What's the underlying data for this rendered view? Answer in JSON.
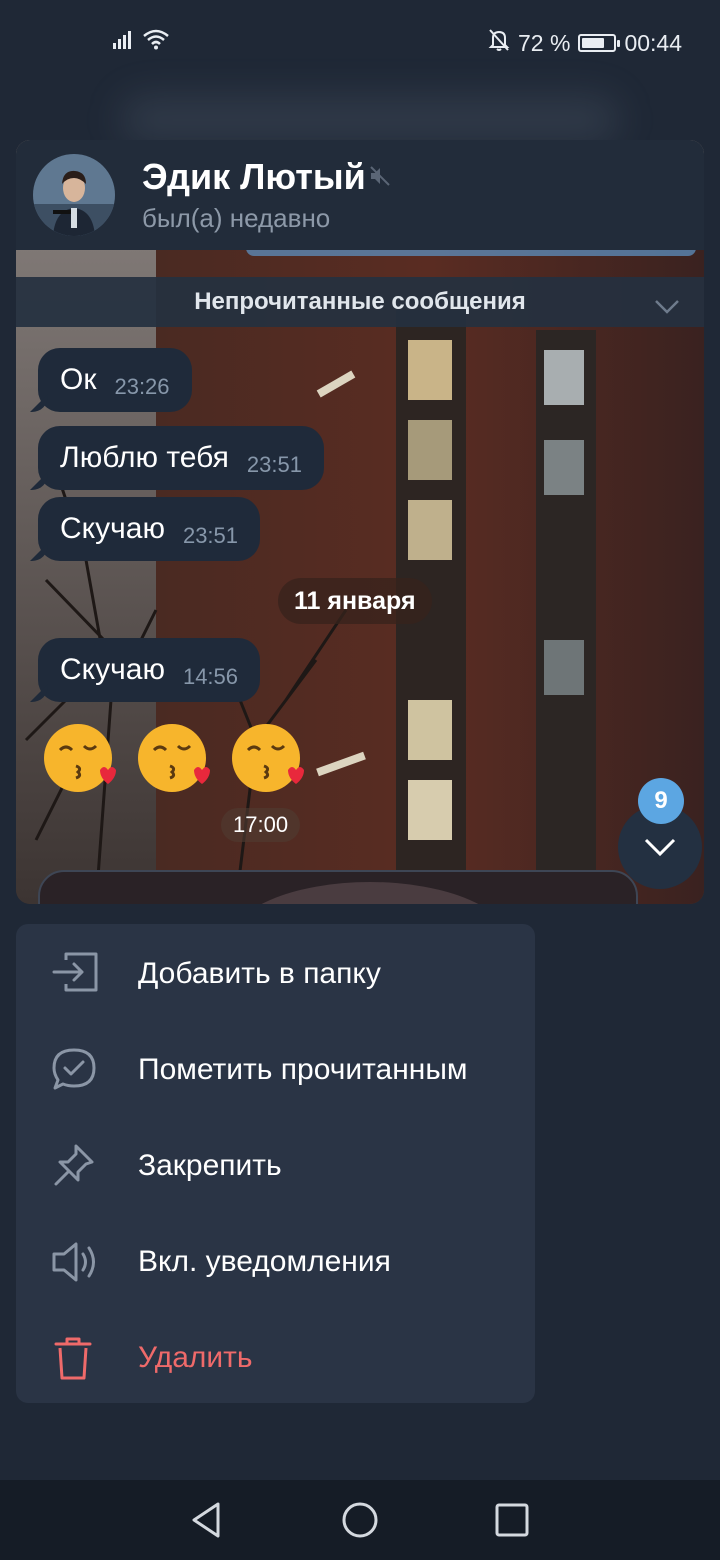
{
  "status_bar": {
    "battery_text": "72 %",
    "battery_level": 0.72,
    "time": "00:44",
    "icons": [
      "signal-icon",
      "wifi-icon",
      "bell-off-icon",
      "battery-icon"
    ]
  },
  "chat": {
    "name": "Эдик Лютый",
    "status": "был(а) недавно",
    "muted": true,
    "unread_bar_label": "Непрочитанные сообщения",
    "messages": [
      {
        "text": "Ок",
        "time": "23:26"
      },
      {
        "text": "Люблю тебя",
        "time": "23:51"
      },
      {
        "text": "Скучаю",
        "time": "23:51"
      },
      {
        "text": "Скучаю",
        "time": "14:56"
      }
    ],
    "date_separator": "11 января",
    "emoji_message": {
      "emoji": "😘😘😘",
      "time": "17:00"
    },
    "unread_count": "9"
  },
  "menu": {
    "items": [
      {
        "label": "Добавить в папку",
        "icon": "folder-add-icon"
      },
      {
        "label": "Пометить прочитанным",
        "icon": "mark-read-icon"
      },
      {
        "label": "Закрепить",
        "icon": "pin-icon"
      },
      {
        "label": "Вкл. уведомления",
        "icon": "speaker-icon"
      },
      {
        "label": "Удалить",
        "icon": "trash-icon",
        "color": "#ef6a6a"
      }
    ]
  },
  "navigation": {
    "buttons": [
      "back-icon",
      "home-icon",
      "recents-icon"
    ]
  },
  "colors": {
    "background": "#1f2836",
    "menu_bg": "#2a3445",
    "accent": "#5ca6e2",
    "danger": "#ef6a6a",
    "bubble": "#1f2a3a"
  }
}
